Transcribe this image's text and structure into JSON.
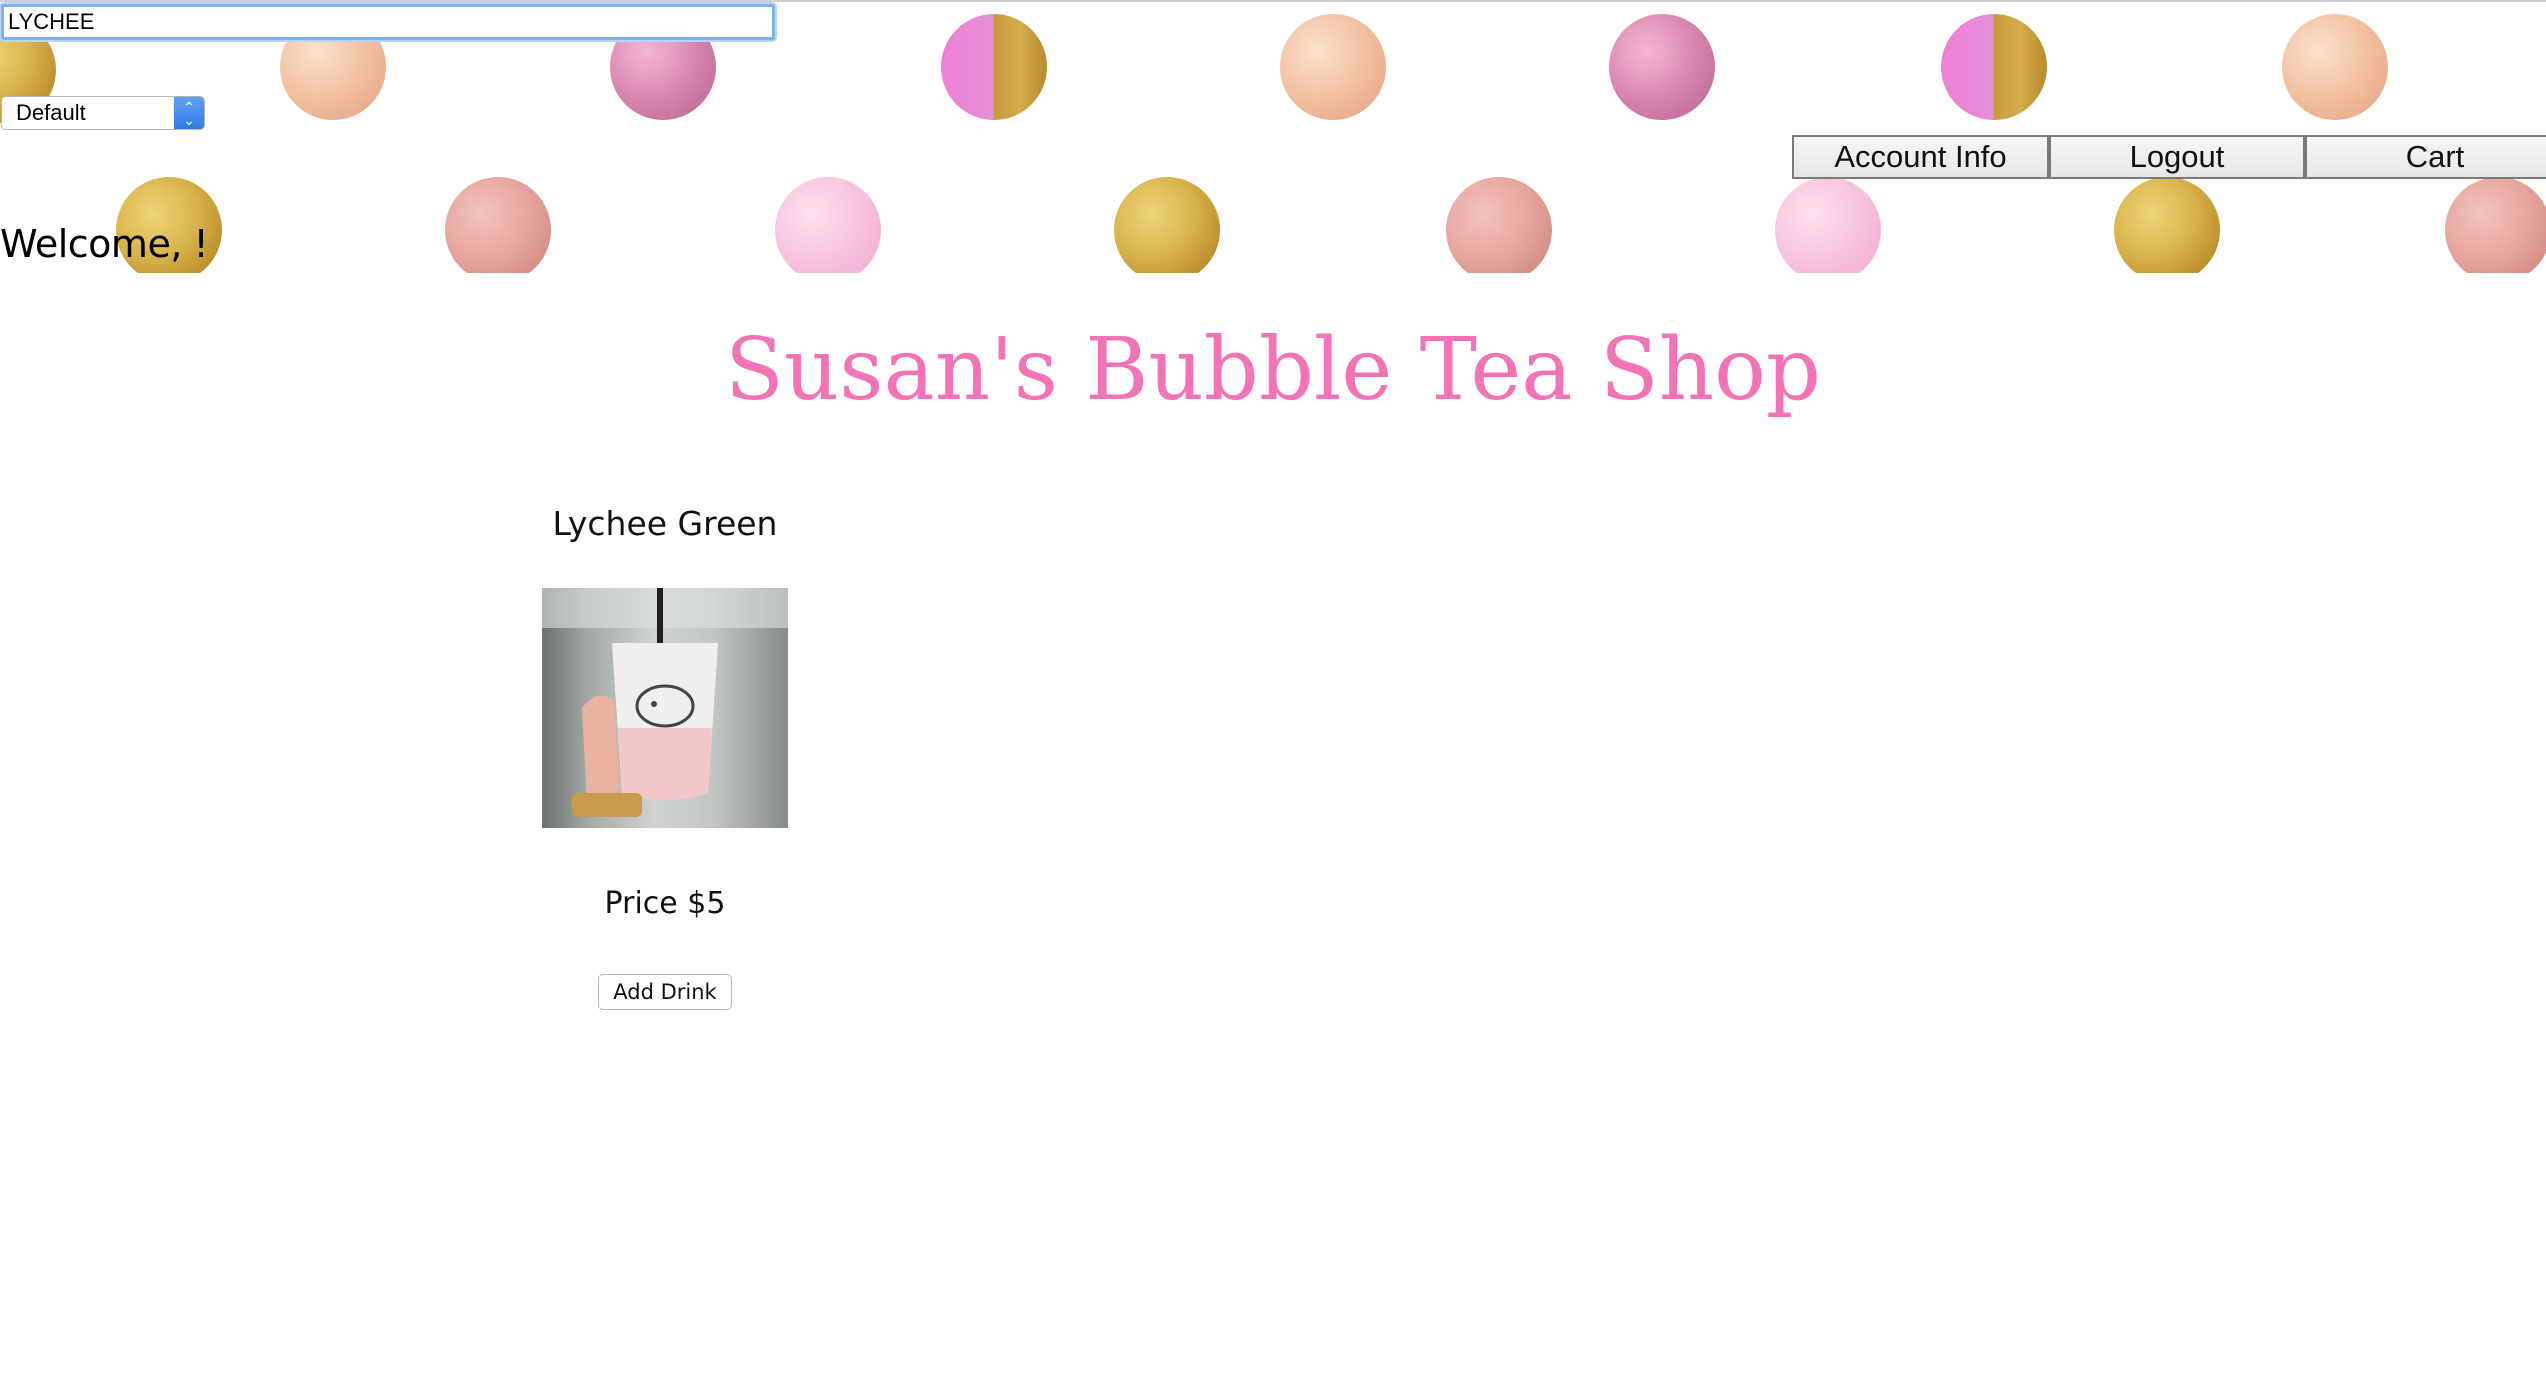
{
  "search": {
    "value": "LYCHEE"
  },
  "sort_select": {
    "selected": "Default"
  },
  "nav": {
    "account_info": "Account Info",
    "logout": "Logout",
    "cart": "Cart"
  },
  "welcome": "Welcome, !",
  "shop_title": "Susan's Bubble Tea Shop",
  "product": {
    "name": "Lychee Green",
    "price_label": "Price $5",
    "add_button": "Add Drink"
  },
  "colors": {
    "title_pink": "#f472b6",
    "focus_blue": "#7fb0f1",
    "select_blue": "#2f7ae5"
  },
  "icons": {
    "select_arrows": "updown-chevron-icon"
  }
}
